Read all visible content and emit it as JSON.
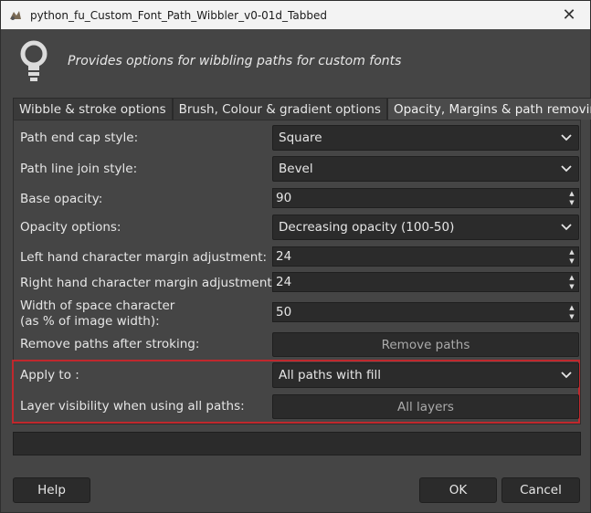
{
  "window": {
    "title": "python_fu_Custom_Font_Path_Wibbler_v0-01d_Tabbed",
    "close_glyph": "✕"
  },
  "header": {
    "icon": "lightbulb-icon",
    "description": "Provides options for wibbling paths for custom fonts"
  },
  "tabs": [
    {
      "label": "Wibble & stroke options",
      "active": false
    },
    {
      "label": "Brush, Colour & gradient options",
      "active": false
    },
    {
      "label": "Opacity, Margins & path removing",
      "active": true
    }
  ],
  "fields": {
    "end_cap": {
      "label": "Path end cap style:",
      "value": "Square"
    },
    "line_join": {
      "label": "Path line join style:",
      "value": "Bevel"
    },
    "base_opacity": {
      "label": "Base opacity:",
      "value": "90"
    },
    "opacity_options": {
      "label": "Opacity options:",
      "value": "Decreasing opacity (100-50)"
    },
    "left_margin": {
      "label": "Left hand character margin adjustment:",
      "value": "24"
    },
    "right_margin": {
      "label": "Right hand character margin adjustment:",
      "value": "24"
    },
    "space_width": {
      "label_line1": "Width of space character",
      "label_line2": "(as % of image width):",
      "value": "50"
    },
    "remove_paths": {
      "label": "Remove paths after stroking:",
      "button": "Remove paths"
    },
    "apply_to": {
      "label": "Apply to :",
      "value": "All paths with fill"
    },
    "layer_visibility": {
      "label": "Layer visibility when using all paths:",
      "button": "All layers"
    }
  },
  "footer": {
    "help": "Help",
    "ok": "OK",
    "cancel": "Cancel"
  },
  "colors": {
    "background": "#454545",
    "field": "#2b2b2b",
    "highlight_border": "#c0282d",
    "titlebar": "#f3f3f3"
  }
}
